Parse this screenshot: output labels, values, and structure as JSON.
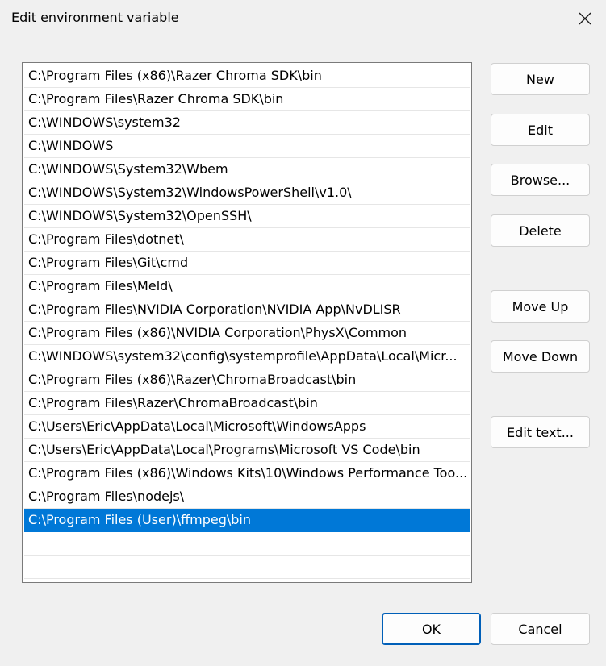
{
  "window": {
    "title": "Edit environment variable",
    "close_icon": "close-icon"
  },
  "list": {
    "items": [
      "C:\\Program Files (x86)\\Razer Chroma SDK\\bin",
      "C:\\Program Files\\Razer Chroma SDK\\bin",
      "C:\\WINDOWS\\system32",
      "C:\\WINDOWS",
      "C:\\WINDOWS\\System32\\Wbem",
      "C:\\WINDOWS\\System32\\WindowsPowerShell\\v1.0\\",
      "C:\\WINDOWS\\System32\\OpenSSH\\",
      "C:\\Program Files\\dotnet\\",
      "C:\\Program Files\\Git\\cmd",
      "C:\\Program Files\\Meld\\",
      "C:\\Program Files\\NVIDIA Corporation\\NVIDIA App\\NvDLISR",
      "C:\\Program Files (x86)\\NVIDIA Corporation\\PhysX\\Common",
      "C:\\WINDOWS\\system32\\config\\systemprofile\\AppData\\Local\\Micr...",
      "C:\\Program Files (x86)\\Razer\\ChromaBroadcast\\bin",
      "C:\\Program Files\\Razer\\ChromaBroadcast\\bin",
      "C:\\Users\\Eric\\AppData\\Local\\Microsoft\\WindowsApps",
      "C:\\Users\\Eric\\AppData\\Local\\Programs\\Microsoft VS Code\\bin",
      "C:\\Program Files (x86)\\Windows Kits\\10\\Windows Performance Too...",
      "C:\\Program Files\\nodejs\\",
      "C:\\Program Files (User)\\ffmpeg\\bin",
      "",
      ""
    ],
    "selected_index": 19
  },
  "buttons": {
    "new": "New",
    "edit": "Edit",
    "browse": "Browse...",
    "delete": "Delete",
    "move_up": "Move Up",
    "move_down": "Move Down",
    "edit_text": "Edit text...",
    "ok": "OK",
    "cancel": "Cancel"
  },
  "colors": {
    "selection": "#0078d7",
    "primary_border": "#005fb8",
    "background": "#f0f0f0"
  }
}
